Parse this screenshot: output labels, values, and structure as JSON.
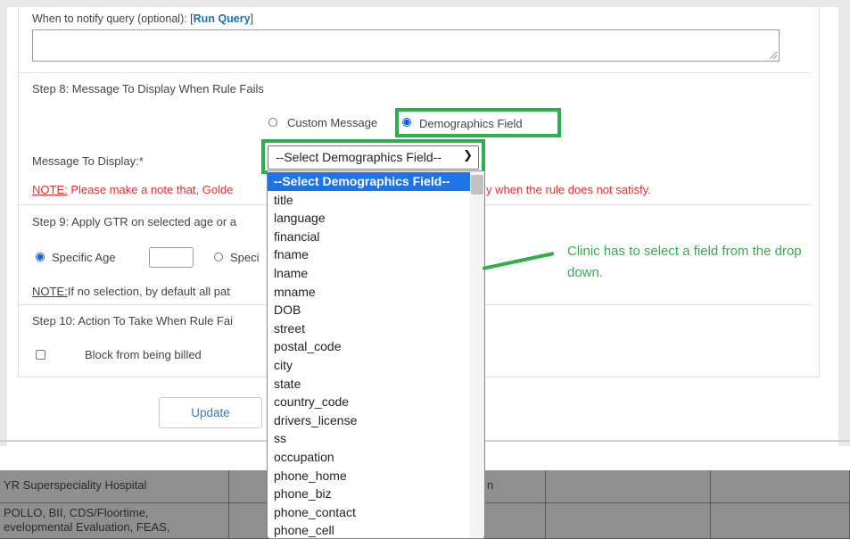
{
  "query": {
    "label": "When to notify query (optional): [",
    "link": "Run Query",
    "label_suffix": "]"
  },
  "step8": {
    "title": "Step 8: Message To Display When Rule Fails",
    "option_custom": "Custom Message",
    "option_demographics": "Demographics Field",
    "selected_option": "Demographics Field",
    "message_label": "Message To Display:*",
    "select_value": "--Select Demographics Field--",
    "note_prefix": "NOTE:",
    "note_text_left": " Please make a note that, Golde",
    "note_text_right": "y when the rule does not satisfy."
  },
  "step9": {
    "title": "Step 9: Apply GTR on selected age or a",
    "option_specific_age": "Specific Age",
    "option_specific_other": "Speci",
    "note_prefix": "NOTE:",
    "note_text": "If no selection, by default all pat"
  },
  "step10": {
    "title": "Step 10: Action To Take When Rule Fai",
    "checkbox_label": "Block from being billed"
  },
  "update_button": "Update",
  "dropdown": {
    "items": [
      "--Select Demographics Field--",
      "title",
      "language",
      "financial",
      "fname",
      "lname",
      "mname",
      "DOB",
      "street",
      "postal_code",
      "city",
      "state",
      "country_code",
      "drivers_license",
      "ss",
      "occupation",
      "phone_home",
      "phone_biz",
      "phone_contact",
      "phone_cell"
    ],
    "selected_index": 0
  },
  "annotation": "Clinic has to select a field from the drop down.",
  "table": {
    "row1_col1": "YR Superspeciality Hospital",
    "row1_col3": "n",
    "row2_col1_line1": "POLLO, BII, CDS/Floortime,",
    "row2_col1_line2": "evelopmental Evaluation, FEAS,"
  },
  "colors": {
    "highlight_green": "#2db04b",
    "link_blue": "#1f6fb5",
    "note_red": "#e03030",
    "select_blue": "#1e73e8"
  }
}
